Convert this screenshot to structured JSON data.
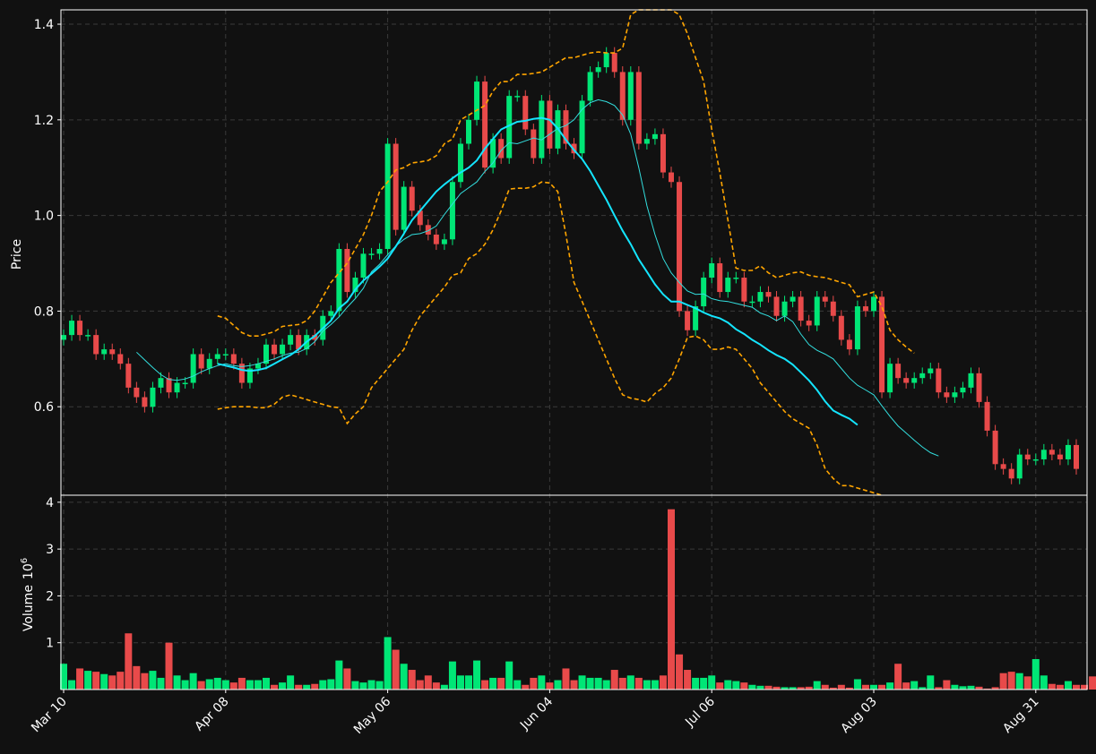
{
  "chart_data": {
    "type": "candlestick",
    "colors": {
      "background": "#111111",
      "up": "#00e676",
      "down": "#e84a4a",
      "ma_fast": "#33dede",
      "ma_slow": "#14e5ff",
      "bollinger": "#ffa500",
      "grid": "#3a3a3a",
      "axis": "#ffffff"
    },
    "price_panel": {
      "ylabel": "Price",
      "yticks": [
        "0.6",
        "0.8",
        "1.0",
        "1.2",
        "1.4"
      ],
      "ylim": [
        0.415,
        1.43
      ]
    },
    "volume_panel": {
      "ylabel": "Volume",
      "ylabel_unit": "10",
      "ylabel_exp": "6",
      "yticks": [
        "1",
        "2",
        "3",
        "4"
      ],
      "ylim": [
        0,
        4.15
      ]
    },
    "x_ticks": [
      {
        "label": "Mar 10",
        "index": 0
      },
      {
        "label": "Apr 08",
        "index": 20
      },
      {
        "label": "May 06",
        "index": 40
      },
      {
        "label": "Jun 04",
        "index": 60
      },
      {
        "label": "Jul 06",
        "index": 80
      },
      {
        "label": "Aug 03",
        "index": 100
      },
      {
        "label": "Aug 31",
        "index": 120
      }
    ],
    "close": [
      0.75,
      0.78,
      0.75,
      0.75,
      0.71,
      0.72,
      0.71,
      0.69,
      0.64,
      0.62,
      0.6,
      0.64,
      0.66,
      0.63,
      0.65,
      0.65,
      0.71,
      0.68,
      0.7,
      0.71,
      0.71,
      0.69,
      0.65,
      0.68,
      0.69,
      0.73,
      0.71,
      0.73,
      0.75,
      0.72,
      0.75,
      0.74,
      0.79,
      0.8,
      0.93,
      0.84,
      0.87,
      0.92,
      0.92,
      0.93,
      1.15,
      0.97,
      1.06,
      1.01,
      0.98,
      0.96,
      0.94,
      0.95,
      1.07,
      1.15,
      1.2,
      1.28,
      1.1,
      1.16,
      1.12,
      1.25,
      1.25,
      1.18,
      1.12,
      1.24,
      1.14,
      1.22,
      1.15,
      1.13,
      1.24,
      1.3,
      1.31,
      1.34,
      1.3,
      1.2,
      1.3,
      1.15,
      1.16,
      1.17,
      1.09,
      1.07,
      0.8,
      0.76,
      0.81,
      0.87,
      0.9,
      0.84,
      0.87,
      0.87,
      0.82,
      0.82,
      0.84,
      0.83,
      0.79,
      0.82,
      0.83,
      0.78,
      0.77,
      0.83,
      0.82,
      0.79,
      0.74,
      0.72,
      0.81,
      0.8,
      0.83,
      0.63,
      0.69,
      0.66,
      0.65,
      0.66,
      0.67,
      0.68,
      0.63,
      0.62,
      0.63,
      0.64,
      0.67,
      0.61,
      0.55,
      0.48,
      0.47,
      0.45,
      0.5,
      0.49,
      0.49,
      0.51,
      0.5,
      0.49,
      0.52,
      0.47
    ],
    "bb_start": 19,
    "bb_upper": [
      0.79,
      0.785,
      0.77,
      0.755,
      0.748,
      0.748,
      0.752,
      0.757,
      0.768,
      0.77,
      0.772,
      0.78,
      0.8,
      0.83,
      0.86,
      0.88,
      0.9,
      0.93,
      0.96,
      1.0,
      1.05,
      1.07,
      1.095,
      1.1,
      1.11,
      1.112,
      1.115,
      1.125,
      1.15,
      1.16,
      1.2,
      1.21,
      1.22,
      1.23,
      1.26,
      1.28,
      1.28,
      1.295,
      1.295,
      1.297,
      1.3,
      1.31,
      1.32,
      1.33,
      1.33,
      1.335,
      1.34,
      1.342,
      1.34,
      1.34,
      1.35,
      1.42,
      1.48,
      1.47,
      1.46,
      1.45,
      1.44,
      1.42,
      1.38,
      1.33,
      1.28,
      1.18,
      1.09,
      0.99,
      0.89,
      0.885,
      0.885,
      0.895,
      0.88,
      0.87,
      0.875,
      0.88,
      0.882,
      0.875,
      0.872,
      0.87,
      0.865,
      0.86,
      0.855,
      0.83,
      0.835,
      0.84,
      0.81,
      0.76,
      0.74,
      0.725,
      0.712
    ],
    "bb_lower": [
      0.595,
      0.598,
      0.6,
      0.6,
      0.6,
      0.598,
      0.598,
      0.605,
      0.62,
      0.625,
      0.62,
      0.615,
      0.61,
      0.605,
      0.6,
      0.598,
      0.565,
      0.585,
      0.6,
      0.64,
      0.66,
      0.68,
      0.7,
      0.72,
      0.76,
      0.79,
      0.81,
      0.83,
      0.85,
      0.875,
      0.88,
      0.91,
      0.92,
      0.94,
      0.97,
      1.01,
      1.055,
      1.057,
      1.057,
      1.06,
      1.07,
      1.068,
      1.05,
      0.96,
      0.86,
      0.82,
      0.78,
      0.74,
      0.7,
      0.66,
      0.625,
      0.618,
      0.615,
      0.61,
      0.628,
      0.64,
      0.66,
      0.7,
      0.745,
      0.748,
      0.74,
      0.72,
      0.72,
      0.725,
      0.72,
      0.7,
      0.68,
      0.65,
      0.63,
      0.61,
      0.59,
      0.575,
      0.565,
      0.555,
      0.52,
      0.47,
      0.45,
      0.435,
      0.435,
      0.43,
      0.425,
      0.42,
      0.41
    ],
    "ma_fast_start": 9,
    "ma_fast": [
      0.714,
      0.698,
      0.682,
      0.667,
      0.657,
      0.655,
      0.658,
      0.664,
      0.673,
      0.68,
      0.686,
      0.69,
      0.686,
      0.684,
      0.686,
      0.69,
      0.695,
      0.7,
      0.707,
      0.712,
      0.714,
      0.722,
      0.736,
      0.758,
      0.772,
      0.788,
      0.808,
      0.826,
      0.848,
      0.882,
      0.898,
      0.918,
      0.936,
      0.95,
      0.96,
      0.962,
      0.968,
      0.978,
      1.002,
      1.024,
      1.046,
      1.058,
      1.07,
      1.092,
      1.11,
      1.136,
      1.152,
      1.15,
      1.156,
      1.162,
      1.158,
      1.17,
      1.182,
      1.188,
      1.2,
      1.222,
      1.236,
      1.242,
      1.238,
      1.23,
      1.21,
      1.17,
      1.1,
      1.02,
      0.96,
      0.91,
      0.88,
      0.86,
      0.842,
      0.835,
      0.836,
      0.826,
      0.822,
      0.82,
      0.816,
      0.812,
      0.808,
      0.796,
      0.79,
      0.78,
      0.79,
      0.778,
      0.752,
      0.73,
      0.718,
      0.71,
      0.7,
      0.68,
      0.66,
      0.645,
      0.635,
      0.625,
      0.602,
      0.58,
      0.56,
      0.545,
      0.53,
      0.516,
      0.504,
      0.497
    ],
    "ma_slow_start": 19,
    "ma_slow": [
      0.69,
      0.686,
      0.682,
      0.677,
      0.675,
      0.677,
      0.681,
      0.69,
      0.699,
      0.708,
      0.72,
      0.736,
      0.748,
      0.764,
      0.78,
      0.806,
      0.82,
      0.845,
      0.864,
      0.878,
      0.893,
      0.91,
      0.935,
      0.962,
      0.99,
      1.01,
      1.03,
      1.05,
      1.065,
      1.078,
      1.09,
      1.1,
      1.115,
      1.14,
      1.16,
      1.18,
      1.188,
      1.196,
      1.198,
      1.202,
      1.204,
      1.2,
      1.182,
      1.158,
      1.137,
      1.118,
      1.093,
      1.063,
      1.033,
      1.0,
      0.968,
      0.94,
      0.908,
      0.882,
      0.856,
      0.835,
      0.82,
      0.82,
      0.813,
      0.806,
      0.797,
      0.79,
      0.785,
      0.776,
      0.762,
      0.752,
      0.74,
      0.73,
      0.718,
      0.708,
      0.7,
      0.688,
      0.672,
      0.655,
      0.635,
      0.611,
      0.592,
      0.583,
      0.575,
      0.562
    ],
    "volume": [
      0.55,
      0.2,
      0.45,
      0.4,
      0.38,
      0.33,
      0.3,
      0.38,
      1.2,
      0.5,
      0.35,
      0.4,
      0.25,
      1.0,
      0.3,
      0.2,
      0.35,
      0.18,
      0.22,
      0.25,
      0.2,
      0.15,
      0.25,
      0.2,
      0.2,
      0.25,
      0.1,
      0.15,
      0.3,
      0.1,
      0.1,
      0.12,
      0.2,
      0.22,
      0.62,
      0.45,
      0.18,
      0.15,
      0.2,
      0.18,
      1.12,
      0.85,
      0.55,
      0.42,
      0.2,
      0.3,
      0.15,
      0.1,
      0.6,
      0.3,
      0.3,
      0.62,
      0.2,
      0.25,
      0.25,
      0.6,
      0.2,
      0.1,
      0.25,
      0.3,
      0.15,
      0.2,
      0.45,
      0.2,
      0.3,
      0.25,
      0.25,
      0.2,
      0.42,
      0.25,
      0.3,
      0.25,
      0.2,
      0.2,
      0.3,
      3.85,
      0.75,
      0.42,
      0.25,
      0.25,
      0.3,
      0.15,
      0.2,
      0.18,
      0.15,
      0.1,
      0.08,
      0.08,
      0.06,
      0.05,
      0.05,
      0.05,
      0.06,
      0.18,
      0.1,
      0.04,
      0.1,
      0.04,
      0.22,
      0.1,
      0.1,
      0.1,
      0.15,
      0.55,
      0.15,
      0.18,
      0.05,
      0.3,
      0.05,
      0.2,
      0.1,
      0.07,
      0.08,
      0.06,
      0.02,
      0.05,
      0.35,
      0.38,
      0.35,
      0.28,
      0.65,
      0.3,
      0.12,
      0.1,
      0.18,
      0.1,
      0.1,
      0.28
    ]
  }
}
